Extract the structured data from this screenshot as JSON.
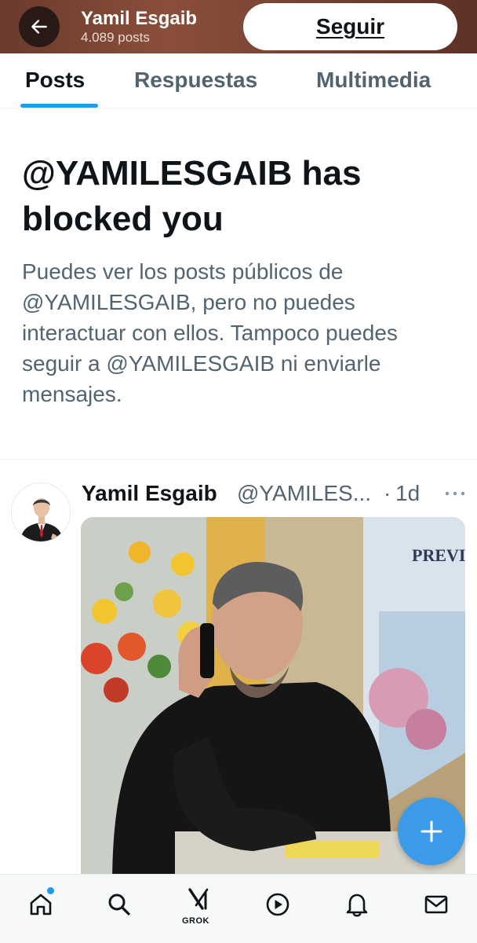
{
  "header": {
    "back_icon": "arrow-left-icon",
    "name": "Yamil Esgaib",
    "post_count": "4.089 posts",
    "follow_label": "Seguir"
  },
  "tabs": [
    {
      "label": "Posts",
      "active": true
    },
    {
      "label": "Respuestas",
      "active": false
    },
    {
      "label": "Multimedia",
      "active": false
    }
  ],
  "blocked": {
    "title": "@YAMILESGAIB has blocked you",
    "description": "Puedes ver los posts públicos de @YAMILESGAIB, pero no puedes interactuar con ellos. Tampoco puedes seguir a @YAMILESGAIB ni enviarle mensajes."
  },
  "post": {
    "author_name": "Yamil Esgaib",
    "handle": "@YAMILES...",
    "separator": "·",
    "time": "1d",
    "more_icon": "more-horizontal-icon",
    "media_sign_text": "PREVI"
  },
  "fab": {
    "icon": "plus-icon"
  },
  "bottom_nav": [
    {
      "icon": "home-icon",
      "has_notification": true
    },
    {
      "icon": "search-icon"
    },
    {
      "icon": "grok-icon",
      "label": "GROK"
    },
    {
      "icon": "play-icon"
    },
    {
      "icon": "bell-icon"
    },
    {
      "icon": "mail-icon"
    }
  ],
  "colors": {
    "accent": "#1d9bf0",
    "text_primary": "#0f1419",
    "text_secondary": "#536471",
    "fab": "#3b9be8"
  }
}
